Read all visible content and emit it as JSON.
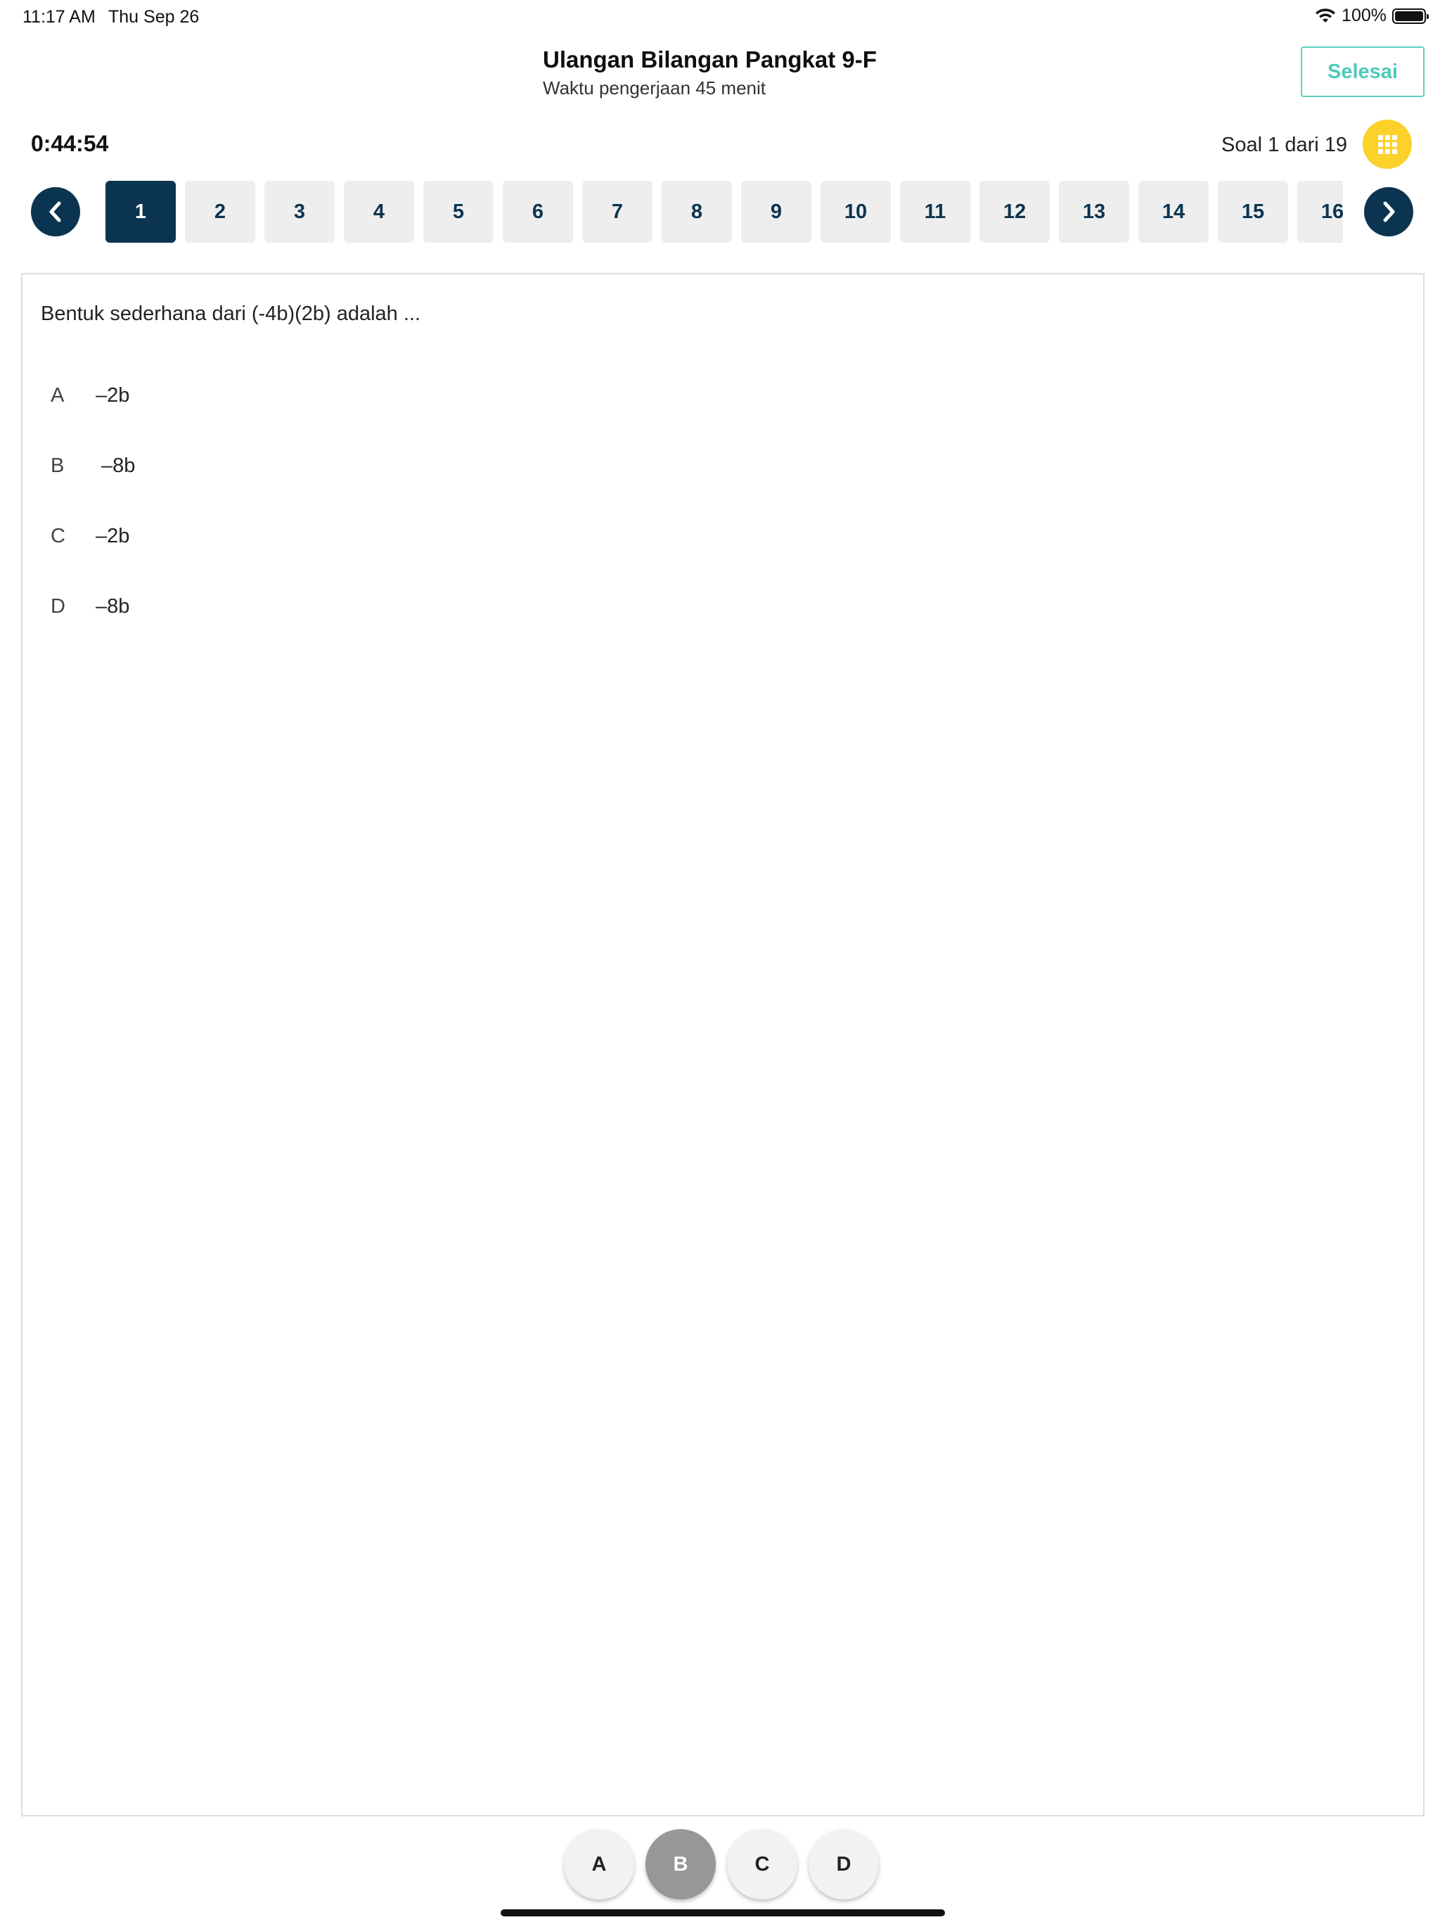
{
  "status_bar": {
    "time": "11:17 AM",
    "date": "Thu Sep 26",
    "battery": "100%",
    "battery_level": 1.0
  },
  "header": {
    "title": "Ulangan Bilangan Pangkat 9-F",
    "subtitle": "Waktu pengerjaan 45 menit",
    "done_label": "Selesai"
  },
  "timer": "0:44:54",
  "question_counter": "Soal 1 dari 19",
  "question_nav": {
    "active": "1",
    "numbers": [
      "1",
      "2",
      "3",
      "4",
      "5",
      "6",
      "7",
      "8",
      "9",
      "10",
      "11",
      "12",
      "13",
      "14",
      "15",
      "16"
    ]
  },
  "question": {
    "text": "Bentuk sederhana dari (-4b)(2b) adalah ...",
    "options": [
      {
        "letter": "A",
        "text": "–2b"
      },
      {
        "letter": "B",
        "text": "–8b"
      },
      {
        "letter": "C",
        "text": "–2b"
      },
      {
        "letter": "D",
        "text": "–8b"
      }
    ]
  },
  "answers": {
    "selected": "B",
    "buttons": [
      "A",
      "B",
      "C",
      "D"
    ]
  },
  "icons": {
    "prev": "chevron-left-icon",
    "next": "chevron-right-icon",
    "grid": "grid-icon",
    "wifi": "wifi-icon",
    "battery": "battery-icon"
  },
  "colors": {
    "primary": "#0b3450",
    "accent_teal": "#4ccab9",
    "grid_button": "#fcd12a",
    "selected_answer": "#979797"
  }
}
